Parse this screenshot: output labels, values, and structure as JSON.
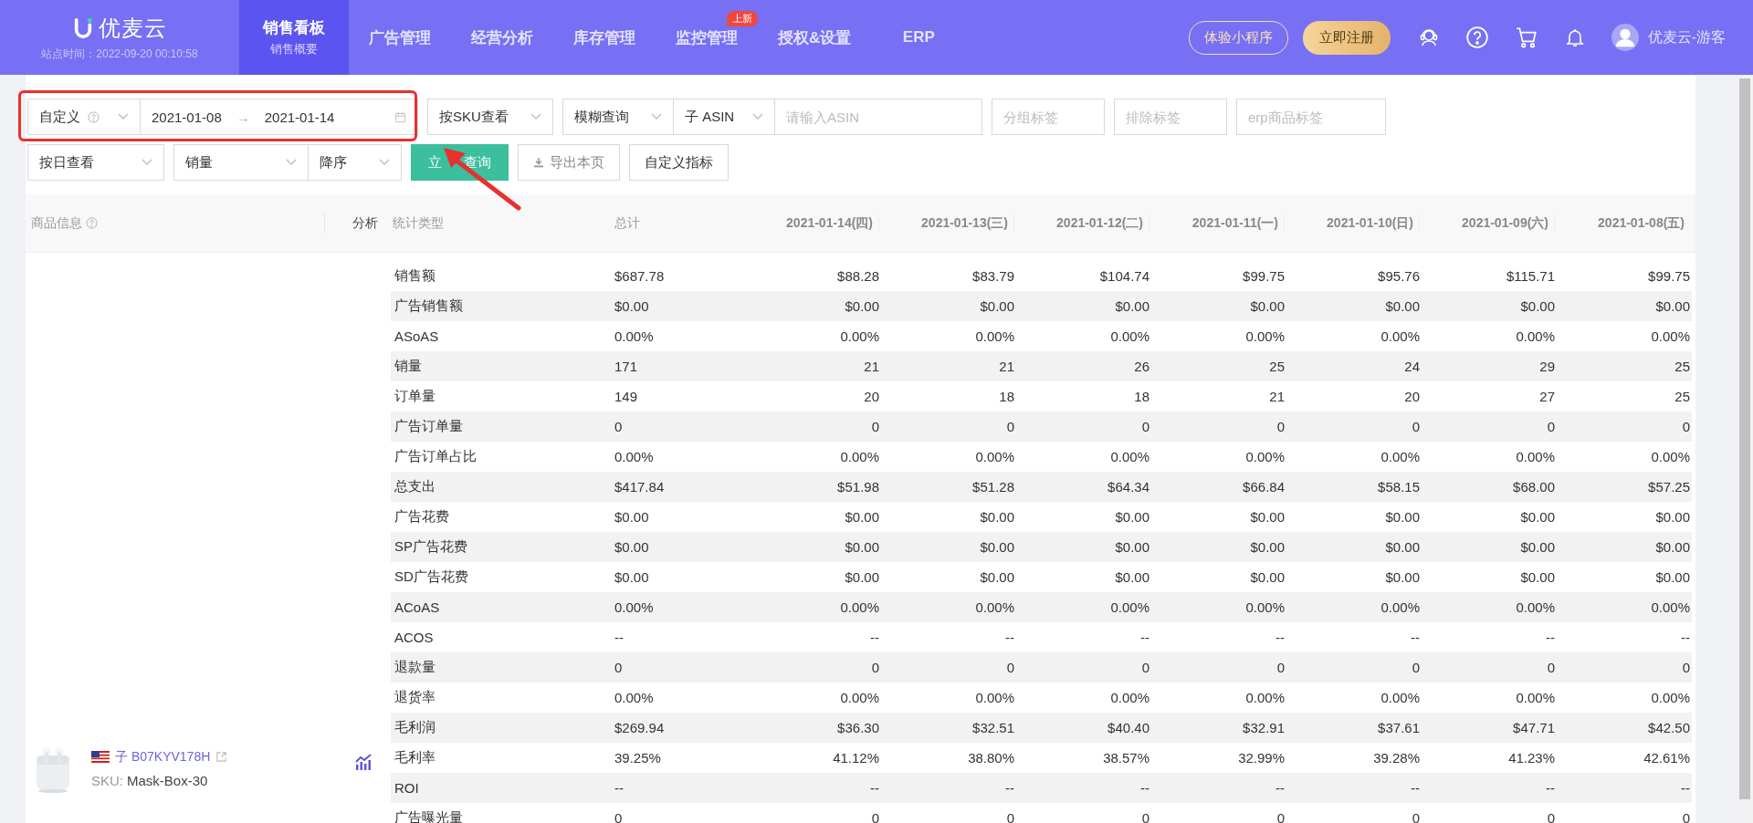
{
  "header": {
    "logo": "优麦云",
    "site_time": "站点时间：2022-09-20 00:10:58",
    "nav": [
      {
        "label": "销售看板",
        "sub": "销售概要",
        "selected": true
      },
      {
        "label": "广告管理",
        "selected": false
      },
      {
        "label": "经营分析",
        "selected": false
      },
      {
        "label": "库存管理",
        "selected": false
      },
      {
        "label": "监控管理",
        "badge": "上新",
        "selected": false
      },
      {
        "label": "授权&设置",
        "selected": false
      },
      {
        "label": "ERP",
        "selected": false
      }
    ],
    "mini_program_button": "体验小程序",
    "register_button": "立即注册",
    "user": "优麦云-游客"
  },
  "filters": {
    "date_mode": "自定义",
    "start_date": "2021-01-08",
    "date_separator": "→",
    "end_date": "2021-01-14",
    "view_by": "按SKU查看",
    "match_mode": "模糊查询",
    "asin_type": "子 ASIN",
    "asin_placeholder": "请输入ASIN",
    "group_tag_placeholder": "分组标签",
    "exclude_tag_placeholder": "排除标签",
    "erp_tag_placeholder": "erp商品标签",
    "period": "按日查看",
    "sort_field": "销量",
    "sort_order": "降序",
    "query_button": "立 查询",
    "export_button": "导出本页",
    "custom_metrics_button": "自定义指标"
  },
  "table": {
    "product_column": "商品信息",
    "analysis_column": "分析",
    "metric_column": "统计类型",
    "total_column": "总计",
    "date_columns": [
      "2021-01-14(四)",
      "2021-01-13(三)",
      "2021-01-12(二)",
      "2021-01-11(一)",
      "2021-01-10(日)",
      "2021-01-09(六)",
      "2021-01-08(五)"
    ],
    "product": {
      "asin": "子 B07KYV178H",
      "sku_label": "SKU:",
      "sku": "Mask-Box-30"
    },
    "rows": [
      {
        "metric": "销售额",
        "values": [
          "$687.78",
          "$88.28",
          "$83.79",
          "$104.74",
          "$99.75",
          "$95.76",
          "$115.71",
          "$99.75"
        ]
      },
      {
        "metric": "广告销售额",
        "values": [
          "$0.00",
          "$0.00",
          "$0.00",
          "$0.00",
          "$0.00",
          "$0.00",
          "$0.00",
          "$0.00"
        ]
      },
      {
        "metric": "ASoAS",
        "values": [
          "0.00%",
          "0.00%",
          "0.00%",
          "0.00%",
          "0.00%",
          "0.00%",
          "0.00%",
          "0.00%"
        ]
      },
      {
        "metric": "销量",
        "values": [
          "171",
          "21",
          "21",
          "26",
          "25",
          "24",
          "29",
          "25"
        ]
      },
      {
        "metric": "订单量",
        "values": [
          "149",
          "20",
          "18",
          "18",
          "21",
          "20",
          "27",
          "25"
        ]
      },
      {
        "metric": "广告订单量",
        "values": [
          "0",
          "0",
          "0",
          "0",
          "0",
          "0",
          "0",
          "0"
        ]
      },
      {
        "metric": "广告订单占比",
        "values": [
          "0.00%",
          "0.00%",
          "0.00%",
          "0.00%",
          "0.00%",
          "0.00%",
          "0.00%",
          "0.00%"
        ]
      },
      {
        "metric": "总支出",
        "values": [
          "$417.84",
          "$51.98",
          "$51.28",
          "$64.34",
          "$66.84",
          "$58.15",
          "$68.00",
          "$57.25"
        ]
      },
      {
        "metric": "广告花费",
        "values": [
          "$0.00",
          "$0.00",
          "$0.00",
          "$0.00",
          "$0.00",
          "$0.00",
          "$0.00",
          "$0.00"
        ]
      },
      {
        "metric": "SP广告花费",
        "values": [
          "$0.00",
          "$0.00",
          "$0.00",
          "$0.00",
          "$0.00",
          "$0.00",
          "$0.00",
          "$0.00"
        ]
      },
      {
        "metric": "SD广告花费",
        "values": [
          "$0.00",
          "$0.00",
          "$0.00",
          "$0.00",
          "$0.00",
          "$0.00",
          "$0.00",
          "$0.00"
        ]
      },
      {
        "metric": "ACoAS",
        "values": [
          "0.00%",
          "0.00%",
          "0.00%",
          "0.00%",
          "0.00%",
          "0.00%",
          "0.00%",
          "0.00%"
        ]
      },
      {
        "metric": "ACOS",
        "values": [
          "--",
          "--",
          "--",
          "--",
          "--",
          "--",
          "--",
          "--"
        ]
      },
      {
        "metric": "退款量",
        "values": [
          "0",
          "0",
          "0",
          "0",
          "0",
          "0",
          "0",
          "0"
        ]
      },
      {
        "metric": "退货率",
        "values": [
          "0.00%",
          "0.00%",
          "0.00%",
          "0.00%",
          "0.00%",
          "0.00%",
          "0.00%",
          "0.00%"
        ]
      },
      {
        "metric": "毛利润",
        "values": [
          "$269.94",
          "$36.30",
          "$32.51",
          "$40.40",
          "$32.91",
          "$37.61",
          "$47.71",
          "$42.50"
        ]
      },
      {
        "metric": "毛利率",
        "values": [
          "39.25%",
          "41.12%",
          "38.80%",
          "38.57%",
          "32.99%",
          "39.28%",
          "41.23%",
          "42.61%"
        ]
      },
      {
        "metric": "ROI",
        "values": [
          "--",
          "--",
          "--",
          "--",
          "--",
          "--",
          "--",
          "--"
        ]
      },
      {
        "metric": "广告曝光量",
        "values": [
          "0",
          "0",
          "0",
          "0",
          "0",
          "0",
          "0",
          "0"
        ]
      }
    ]
  },
  "annotations": {
    "highlight_frame": true,
    "arrow": true
  }
}
